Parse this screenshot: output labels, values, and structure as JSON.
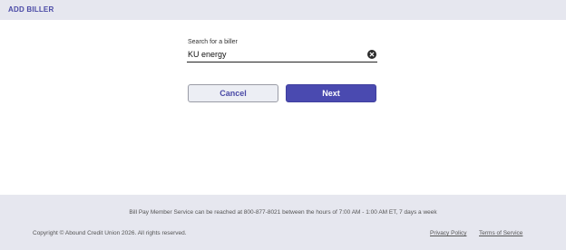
{
  "header": {
    "title": "ADD BILLER"
  },
  "search": {
    "label": "Search for a biller",
    "value": "KU energy",
    "clear_icon": "clear-circle-x"
  },
  "actions": {
    "cancel_label": "Cancel",
    "next_label": "Next"
  },
  "footer": {
    "service_text": "Bill Pay Member Service can be reached at 800-877-8021 between the hours of 7:00 AM - 1:00 AM ET, 7 days a week",
    "copyright": "Copyright © Abound Credit Union 2026.  All rights reserved.",
    "privacy_label": "Privacy Policy",
    "terms_label": "Terms of Service"
  },
  "colors": {
    "accent": "#4a4ab0",
    "header_bg": "#e6e7ef",
    "footer_bg": "#e6e7ef"
  }
}
